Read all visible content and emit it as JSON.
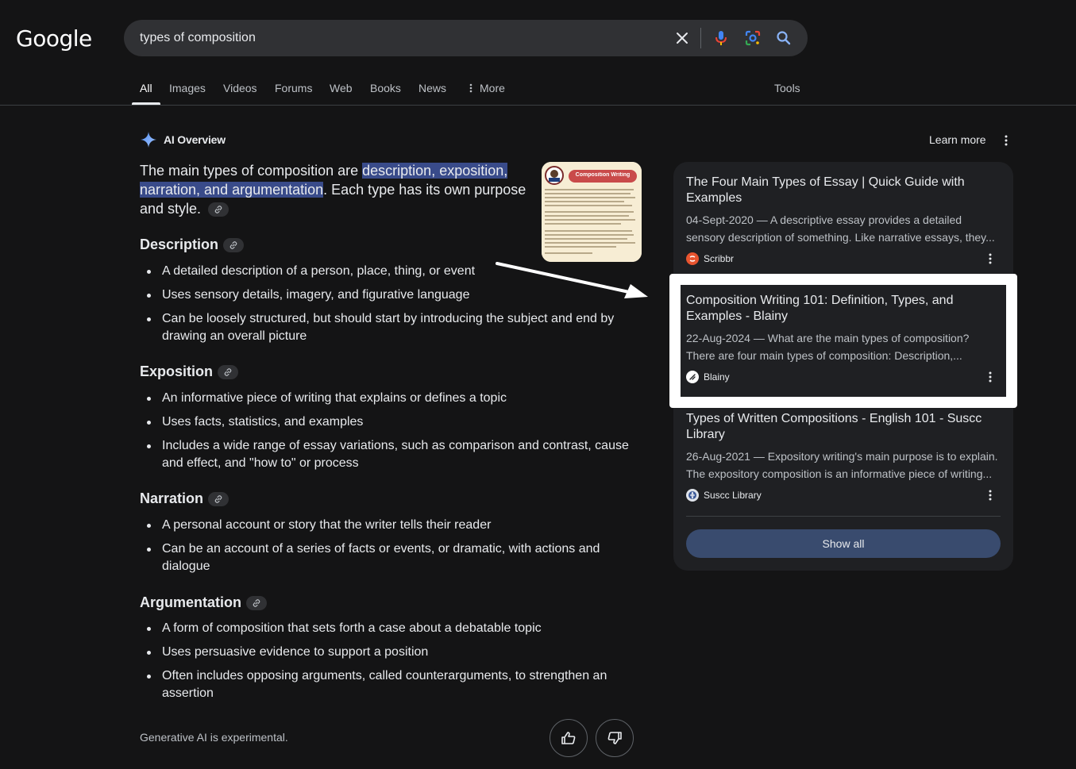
{
  "logo": "Google",
  "search": {
    "query": "types of composition",
    "clear_icon": "close-icon",
    "mic_icon": "mic-icon",
    "lens_icon": "camera-lens-icon",
    "search_icon": "search-icon"
  },
  "tabs": [
    {
      "label": "All",
      "active": true
    },
    {
      "label": "Images"
    },
    {
      "label": "Videos"
    },
    {
      "label": "Forums"
    },
    {
      "label": "Web"
    },
    {
      "label": "Books"
    },
    {
      "label": "News"
    },
    {
      "label": "More"
    }
  ],
  "tools": "Tools",
  "ai_overview": {
    "title": "AI Overview",
    "learn_more": "Learn more",
    "intro_before": "The main types of composition are ",
    "intro_highlight": "description, exposition, narration, and argumentation",
    "intro_after": ". Each type has its own purpose and style.",
    "thumbnail_label": "Composition Writing",
    "sections": [
      {
        "heading": "Description",
        "bullets": [
          "A detailed description of a person, place, thing, or event",
          "Uses sensory details, imagery, and figurative language",
          "Can be loosely structured, but should start by introducing the subject and end by drawing an overall picture"
        ]
      },
      {
        "heading": "Exposition",
        "bullets": [
          "An informative piece of writing that explains or defines a topic",
          "Uses facts, statistics, and examples",
          "Includes a wide range of essay variations, such as comparison and contrast, cause and effect, and \"how to\" or process"
        ]
      },
      {
        "heading": "Narration",
        "bullets": [
          "A personal account or story that the writer tells their reader",
          "Can be an account of a series of facts or events, or dramatic, with actions and dialogue"
        ]
      },
      {
        "heading": "Argumentation",
        "bullets": [
          "A form of composition that sets forth a case about a debatable topic",
          "Uses persuasive evidence to support a position",
          "Often includes opposing arguments, called counterarguments, to strengthen an assertion"
        ]
      }
    ],
    "footer_note": "Generative AI is experimental."
  },
  "sources": [
    {
      "title": "The Four Main Types of Essay | Quick Guide with Examples",
      "snippet": "04-Sept-2020 — A descriptive essay provides a detailed sensory description of something. Like narrative essays, they...",
      "site": "Scribbr",
      "favicon_color": "#e8542f"
    },
    {
      "title": "Composition Writing 101: Definition, Types, and Examples - Blainy",
      "snippet": "22-Aug-2024 — What are the main types of composition? There are four main types of composition: Description,...",
      "site": "Blainy",
      "favicon_color": "#ffffff"
    },
    {
      "title": "Types of Written Compositions - English 101 - Suscc Library",
      "snippet": "26-Aug-2021 — Expository writing's main purpose is to explain. The expository composition is an informative piece of writing...",
      "site": "Suscc Library",
      "favicon_color": "#3c5a99"
    }
  ],
  "show_all": "Show all"
}
